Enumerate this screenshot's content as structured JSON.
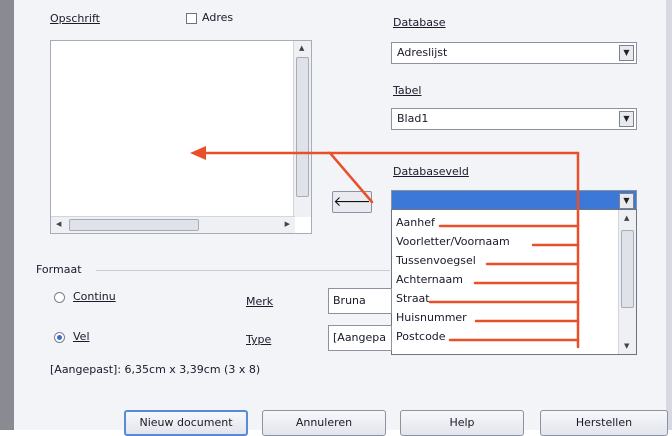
{
  "left": {
    "label_text": "Opschrift",
    "checkbox_label": "Adres"
  },
  "right": {
    "database_label": "Database",
    "database_value": "Adreslijst",
    "table_label": "Tabel",
    "table_value": "Blad1",
    "field_label": "Databaseveld",
    "field_value": "",
    "field_options": [
      "Aanhef",
      "Voorletter/Voornaam",
      "Tussenvoegsel",
      "Achternaam",
      "Straat",
      "Huisnummer",
      "Postcode"
    ]
  },
  "format": {
    "section_label": "Formaat",
    "radio_continu": "Continu",
    "radio_vel": "Vel",
    "brand_label": "Merk",
    "brand_value": "Bruna",
    "type_label": "Type",
    "type_value": "[Aangepa",
    "size_text": "[Aangepast]: 6,35cm x 3,39cm (3 x 8)"
  },
  "buttons": {
    "new_document": "Nieuw document",
    "cancel": "Annuleren",
    "help": "Help",
    "reset": "Herstellen"
  },
  "colors": {
    "annotation": "#e8502a",
    "selection": "#3b78d8"
  }
}
